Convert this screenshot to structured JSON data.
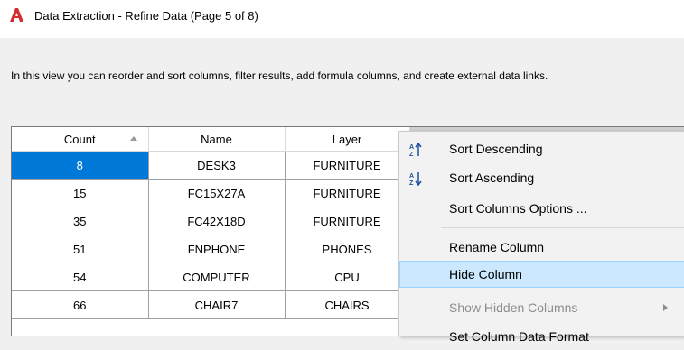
{
  "window": {
    "title": "Data Extraction - Refine Data (Page 5 of 8)",
    "app_icon": "autocad-logo-icon",
    "accent_color": "#d32f2f"
  },
  "description": "In this view you can reorder and sort columns, filter results, add formula columns, and create external data links.",
  "table": {
    "columns": [
      "Count",
      "Name",
      "Layer"
    ],
    "sorted_column": "Count",
    "sort_direction": "ascending",
    "rows": [
      {
        "count": "8",
        "name": "DESK3",
        "layer": "FURNITURE",
        "selected": true
      },
      {
        "count": "15",
        "name": "FC15X27A",
        "layer": "FURNITURE"
      },
      {
        "count": "35",
        "name": "FC42X18D",
        "layer": "FURNITURE"
      },
      {
        "count": "51",
        "name": "FNPHONE",
        "layer": "PHONES"
      },
      {
        "count": "54",
        "name": "COMPUTER",
        "layer": "CPU"
      },
      {
        "count": "66",
        "name": "CHAIR7",
        "layer": "CHAIRS"
      }
    ]
  },
  "context_menu": {
    "items": [
      {
        "label": "Sort Descending",
        "icon": "sort-descending-icon"
      },
      {
        "label": "Sort Ascending",
        "icon": "sort-ascending-icon"
      },
      {
        "label": "Sort Columns Options ..."
      },
      {
        "label": "Rename Column"
      },
      {
        "label": "Hide Column",
        "highlighted": true
      },
      {
        "label": "Show Hidden Columns",
        "disabled": true,
        "submenu": true
      },
      {
        "label": "Set Column Data Format"
      }
    ]
  }
}
